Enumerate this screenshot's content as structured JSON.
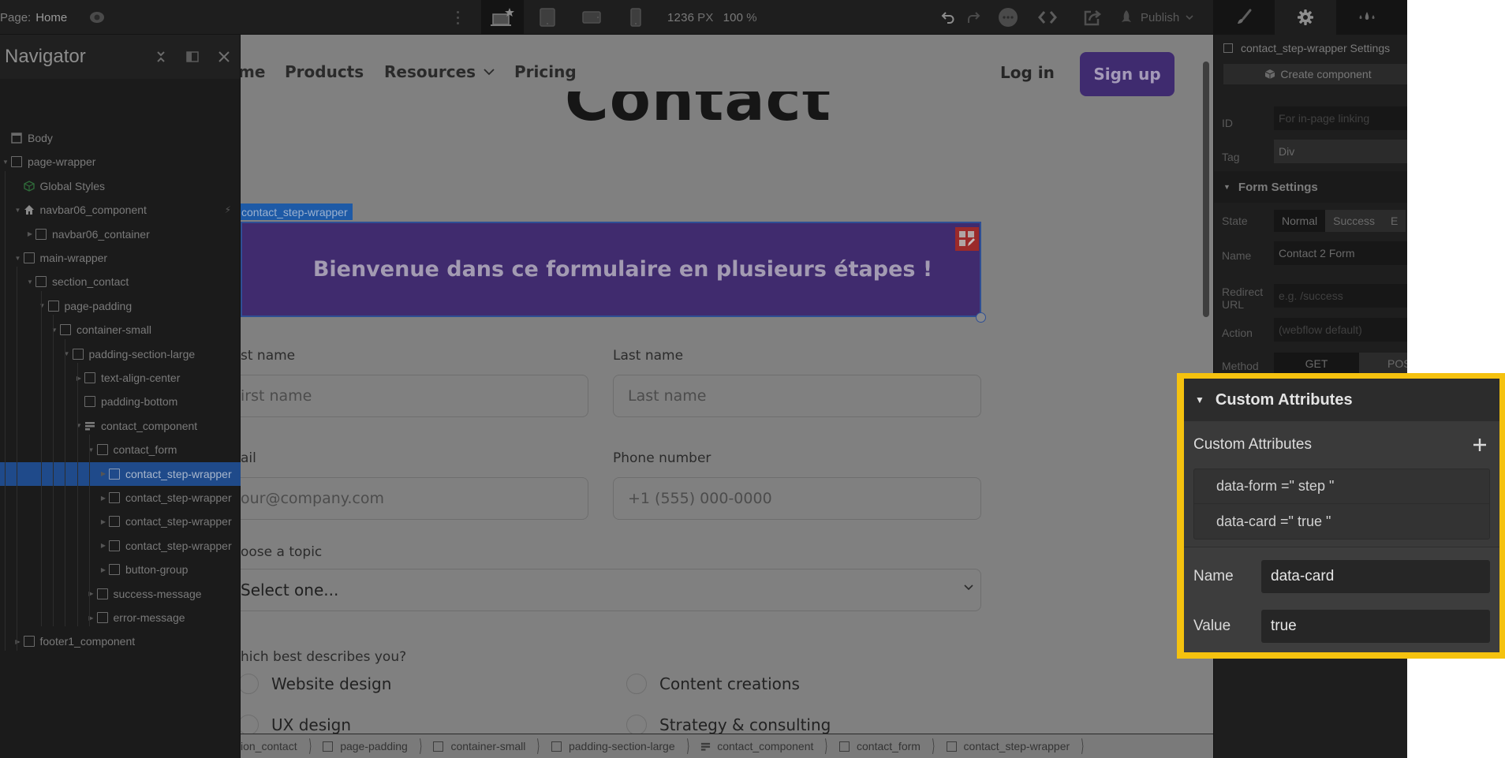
{
  "topbar": {
    "page_label": "Page:",
    "page_name": "Home",
    "breakpoints": [
      "desktop-base",
      "tablet",
      "mobile-landscape",
      "mobile-portrait"
    ],
    "active_breakpoint": "desktop-base",
    "canvas_width": "1236",
    "canvas_width_unit": "PX",
    "zoom": "100",
    "zoom_unit": "%",
    "publish_label": "Publish"
  },
  "panel_tabs": [
    {
      "name": "style",
      "icon": "brush-icon",
      "active": false
    },
    {
      "name": "settings",
      "icon": "gear-icon",
      "active": true
    },
    {
      "name": "interactions",
      "icon": "drops-icon",
      "active": false
    }
  ],
  "navigator": {
    "title": "Navigator",
    "tree": [
      {
        "label": "Body",
        "depth": 0,
        "caret": "",
        "icon": "body"
      },
      {
        "label": "page-wrapper",
        "depth": 0,
        "caret": "open",
        "icon": "box"
      },
      {
        "label": "Global Styles",
        "depth": 1,
        "caret": "",
        "icon": "component"
      },
      {
        "label": "navbar06_component",
        "depth": 1,
        "caret": "open",
        "icon": "home",
        "badge": "lightning"
      },
      {
        "label": "navbar06_container",
        "depth": 2,
        "caret": "closed",
        "icon": "box"
      },
      {
        "label": "main-wrapper",
        "depth": 1,
        "caret": "open",
        "icon": "box"
      },
      {
        "label": "section_contact",
        "depth": 2,
        "caret": "open",
        "icon": "box"
      },
      {
        "label": "page-padding",
        "depth": 3,
        "caret": "open",
        "icon": "box"
      },
      {
        "label": "container-small",
        "depth": 4,
        "caret": "open",
        "icon": "box"
      },
      {
        "label": "padding-section-large",
        "depth": 5,
        "caret": "open",
        "icon": "box"
      },
      {
        "label": "text-align-center",
        "depth": 6,
        "caret": "closed",
        "icon": "box"
      },
      {
        "label": "padding-bottom",
        "depth": 6,
        "caret": "",
        "icon": "box"
      },
      {
        "label": "contact_component",
        "depth": 6,
        "caret": "open",
        "icon": "form"
      },
      {
        "label": "contact_form",
        "depth": 7,
        "caret": "open",
        "icon": "box"
      },
      {
        "label": "contact_step-wrapper",
        "depth": 8,
        "caret": "closed",
        "icon": "box",
        "selected": true
      },
      {
        "label": "contact_step-wrapper",
        "depth": 8,
        "caret": "closed",
        "icon": "box"
      },
      {
        "label": "contact_step-wrapper",
        "depth": 8,
        "caret": "closed",
        "icon": "box"
      },
      {
        "label": "contact_step-wrapper",
        "depth": 8,
        "caret": "closed",
        "icon": "box"
      },
      {
        "label": "button-group",
        "depth": 8,
        "caret": "closed",
        "icon": "box"
      },
      {
        "label": "success-message",
        "depth": 7,
        "caret": "closed",
        "icon": "box"
      },
      {
        "label": "error-message",
        "depth": 7,
        "caret": "closed",
        "icon": "box"
      },
      {
        "label": "footer1_component",
        "depth": 1,
        "caret": "closed",
        "icon": "box"
      }
    ]
  },
  "canvas": {
    "nav_links": [
      "me",
      "Products",
      "Resources",
      "Pricing"
    ],
    "login": "Log in",
    "signup": "Sign up",
    "heading": "Contact",
    "selected_tag": "contact_step-wrapper",
    "step_title": "Bienvenue dans ce formulaire en plusieurs étapes !",
    "form": {
      "first_name_label": "st name",
      "first_name_placeholder": "irst name",
      "last_name_label": "Last name",
      "last_name_placeholder": "Last name",
      "email_label": "ail",
      "email_placeholder": "our@company.com",
      "phone_label": "Phone number",
      "phone_placeholder": "+1 (555) 000-0000",
      "topic_label": "oose a topic",
      "topic_selected": "Select one...",
      "describe_label": "hich best describes you?",
      "radio_options": [
        "Website design",
        "Content creations",
        "UX design",
        "Strategy & consulting"
      ]
    }
  },
  "breadcrumbs": [
    {
      "label": "ion_contact",
      "icon": ""
    },
    {
      "label": "page-padding",
      "icon": "box"
    },
    {
      "label": "container-small",
      "icon": "box"
    },
    {
      "label": "padding-section-large",
      "icon": "box"
    },
    {
      "label": "contact_component",
      "icon": "form"
    },
    {
      "label": "contact_form",
      "icon": "box"
    },
    {
      "label": "contact_step-wrapper",
      "icon": "box"
    }
  ],
  "settings": {
    "title": "contact_step-wrapper Settings",
    "create_component": "Create component",
    "id_label": "ID",
    "id_placeholder": "For in-page linking",
    "tag_label": "Tag",
    "tag_value": "Div",
    "form_settings_header": "Form Settings",
    "state_label": "State",
    "state_options": [
      "Normal",
      "Success",
      "E"
    ],
    "name_label": "Name",
    "name_value": "Contact 2 Form",
    "redirect_label": "Redirect URL",
    "redirect_placeholder": "e.g. /success",
    "action_label": "Action",
    "action_placeholder": "(webflow default)",
    "method_label": "Method",
    "method_options": [
      "GET",
      "POS"
    ]
  },
  "custom_attributes": {
    "header": "Custom Attributes",
    "sub_label": "Custom Attributes",
    "items": [
      {
        "name": "data-form",
        "value": "step",
        "display": "data-form =\" step \""
      },
      {
        "name": "data-card",
        "value": "true",
        "display": "data-card =\" true \""
      }
    ],
    "edit": {
      "name_label": "Name",
      "name_value": "data-card",
      "value_label": "Value",
      "value_value": "true"
    },
    "highlight_color": "#f5c20f"
  }
}
